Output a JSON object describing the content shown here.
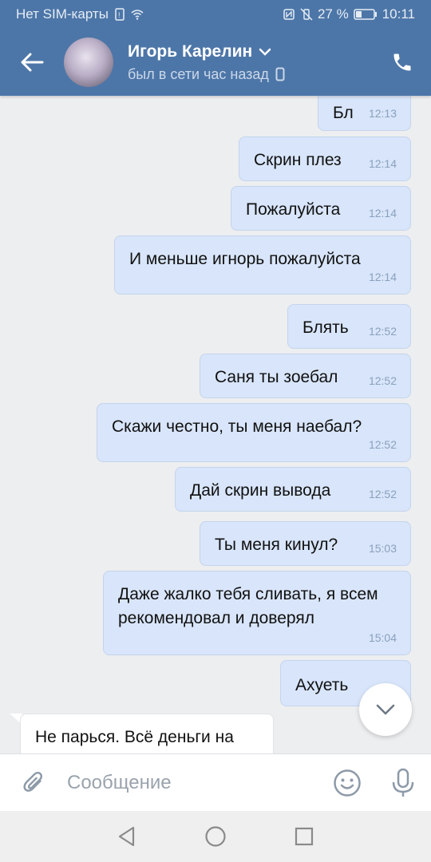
{
  "statusbar": {
    "carrier": "Нет SIM-карты",
    "battery_percent": "27 %",
    "time": "10:11"
  },
  "header": {
    "name": "Игорь Карелин",
    "status": "был в сети час назад"
  },
  "messages": [
    {
      "text": "Бл",
      "time": "12:13",
      "dir": "out"
    },
    {
      "text": "Скрин плез",
      "time": "12:14",
      "dir": "out"
    },
    {
      "text": "Пожалуйста",
      "time": "12:14",
      "dir": "out"
    },
    {
      "text": "И меньше игнорь пожалуйста",
      "time": "12:14",
      "dir": "out"
    },
    {
      "text": "Блять",
      "time": "12:52",
      "dir": "out"
    },
    {
      "text": "Саня ты зоебал",
      "time": "12:52",
      "dir": "out"
    },
    {
      "text": "Скажи честно, ты меня наебал?",
      "time": "12:52",
      "dir": "out"
    },
    {
      "text": "Дай скрин вывода",
      "time": "12:52",
      "dir": "out"
    },
    {
      "text": "Ты меня кинул?",
      "time": "15:03",
      "dir": "out"
    },
    {
      "text": "Даже жалко тебя сливать, я всем рекомендовал и доверял",
      "time": "15:04",
      "dir": "out"
    },
    {
      "text": "Ахуеть",
      "time": "",
      "dir": "out"
    },
    {
      "text": "Не парься. Всё деньги на",
      "time": "",
      "dir": "in"
    }
  ],
  "composer": {
    "placeholder": "Сообщение"
  },
  "icons": {
    "back": "arrow-left-icon",
    "call": "phone-icon",
    "chevron": "chevron-down-icon",
    "mobile": "mobile-device-icon",
    "attach": "paperclip-icon",
    "emoji": "emoji-icon",
    "mic": "microphone-icon",
    "scroll": "chevron-down-icon"
  },
  "colors": {
    "header": "#4d76a8",
    "outgoing_bubble": "#d8e5fa",
    "background": "#edeef0"
  }
}
